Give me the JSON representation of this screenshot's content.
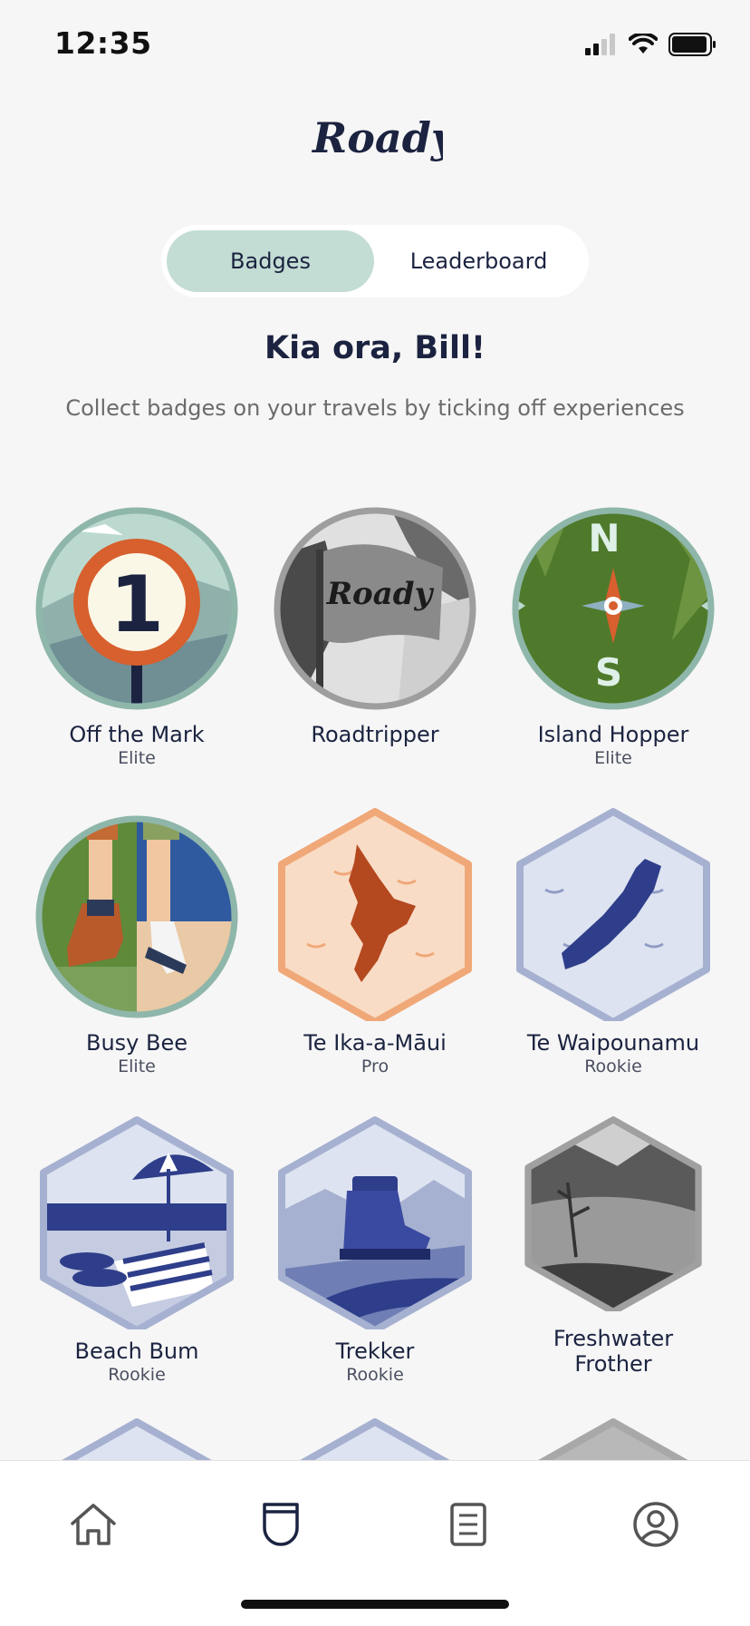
{
  "status": {
    "time": "12:35"
  },
  "app": {
    "logo_text": "Roady"
  },
  "segment": {
    "badges": "Badges",
    "leaderboard": "Leaderboard",
    "active": "Badges"
  },
  "greeting": "Kia ora, Bill!",
  "subtitle": "Collect badges on your travels by ticking off experiences",
  "badges": [
    {
      "name": "Off the Mark",
      "level": "Elite"
    },
    {
      "name": "Roadtripper",
      "level": ""
    },
    {
      "name": "Island Hopper",
      "level": "Elite"
    },
    {
      "name": "Busy Bee",
      "level": "Elite"
    },
    {
      "name": "Te Ika-a-Māui",
      "level": "Pro"
    },
    {
      "name": "Te Waipounamu",
      "level": "Rookie"
    },
    {
      "name": "Beach Bum",
      "level": "Rookie"
    },
    {
      "name": "Trekker",
      "level": "Rookie"
    },
    {
      "name": "Freshwater Frother",
      "level": ""
    }
  ],
  "badge_art": {
    "off_the_mark": "1",
    "roadtripper_flag": "Roady",
    "compass_north": "N",
    "compass_south": "S"
  },
  "tabs": [
    "home-icon",
    "badge-icon",
    "list-icon",
    "profile-icon"
  ],
  "colors": {
    "accent": "#c3ddd4",
    "text": "#1b2340",
    "background": "#f6f6f6"
  }
}
